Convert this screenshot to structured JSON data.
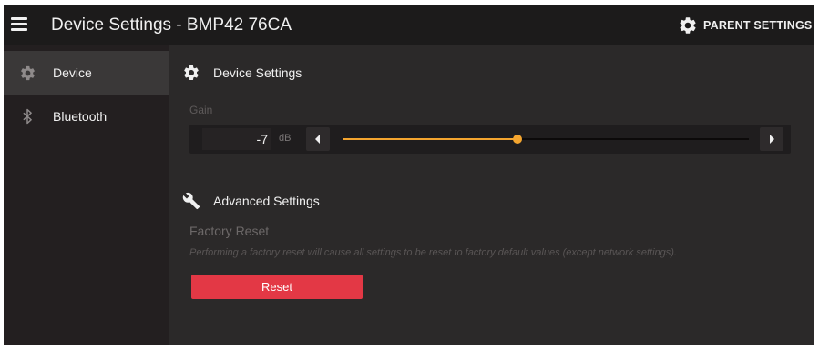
{
  "header": {
    "title": "Device Settings - BMP42 76CA",
    "parent_settings_label": "PARENT SETTINGS"
  },
  "sidebar": {
    "items": [
      {
        "label": "Device",
        "icon": "gear-icon",
        "active": true
      },
      {
        "label": "Bluetooth",
        "icon": "bluetooth-icon",
        "active": false
      }
    ]
  },
  "device_settings": {
    "heading": "Device Settings",
    "gain": {
      "label": "Gain",
      "value": "-7",
      "unit": "dB",
      "slider_fraction": 0.43
    }
  },
  "advanced_settings": {
    "heading": "Advanced Settings",
    "factory_reset": {
      "title": "Factory Reset",
      "description": "Performing a factory reset will cause all settings to be reset to factory default values (except network settings).",
      "button_label": "Reset"
    }
  },
  "colors": {
    "background": "#2b2929",
    "topbar": "#1c1b1b",
    "sidebar": "#231f20",
    "sidebar_active": "#3a3838",
    "accent": "#f4a52f",
    "reset_button": "#e33845"
  }
}
